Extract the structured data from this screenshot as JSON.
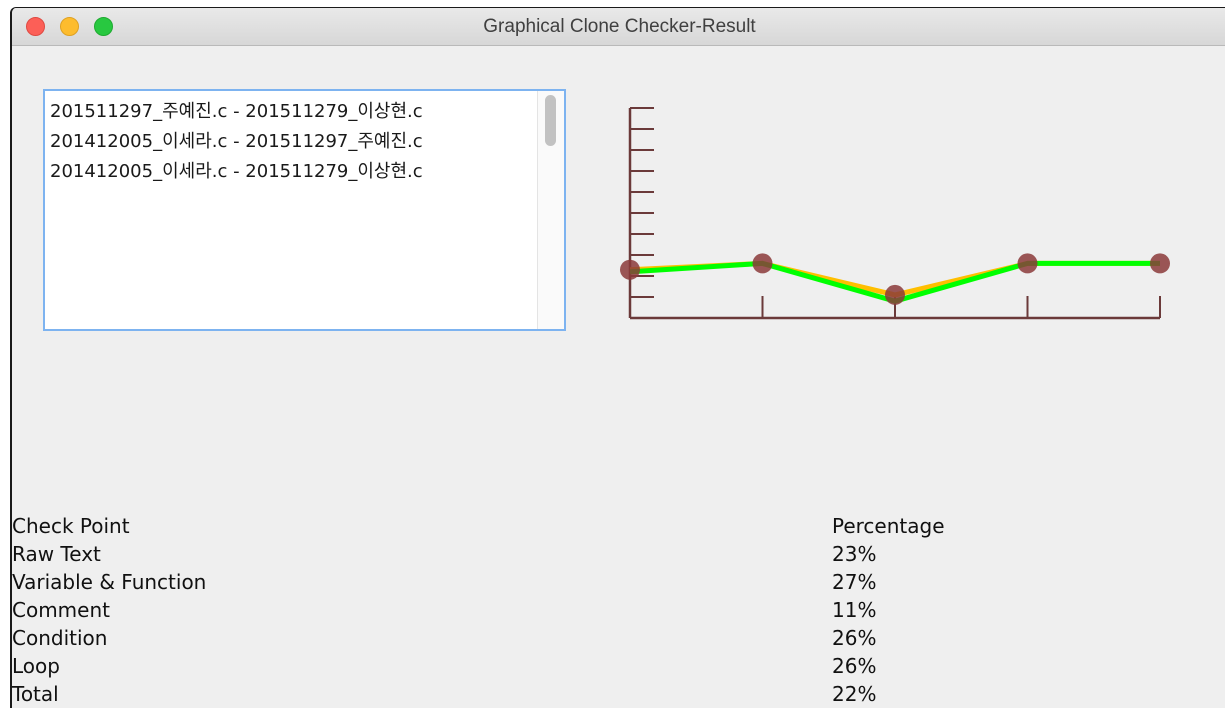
{
  "window": {
    "title": "Graphical Clone Checker-Result"
  },
  "file_pairs": [
    "201511297_주예진.c - 201511279_이상현.c",
    "201412005_이세라.c - 201511297_주예진.c",
    "201412005_이세라.c - 201511279_이상현.c"
  ],
  "table": {
    "headers": [
      "Check Point",
      "Percentage"
    ],
    "rows": [
      [
        "Raw Text",
        "23%"
      ],
      [
        "Variable & Function",
        "27%"
      ],
      [
        "Comment",
        "11%"
      ],
      [
        "Condition",
        "26%"
      ],
      [
        "Loop",
        "26%"
      ],
      [
        "Total",
        "22%"
      ]
    ]
  },
  "chart_data": {
    "type": "line",
    "x": [
      1,
      2,
      3,
      4,
      5
    ],
    "ylim": [
      0,
      100
    ],
    "y_tick_count": 10,
    "series": [
      {
        "values": [
          23,
          26,
          11,
          26,
          26
        ],
        "color": "#ffbf00"
      },
      {
        "values": [
          22,
          26,
          8,
          26,
          26
        ],
        "color": "#00ff00"
      }
    ],
    "marker_color": "#8b3a3a",
    "axis_color": "#6b3a3a"
  }
}
